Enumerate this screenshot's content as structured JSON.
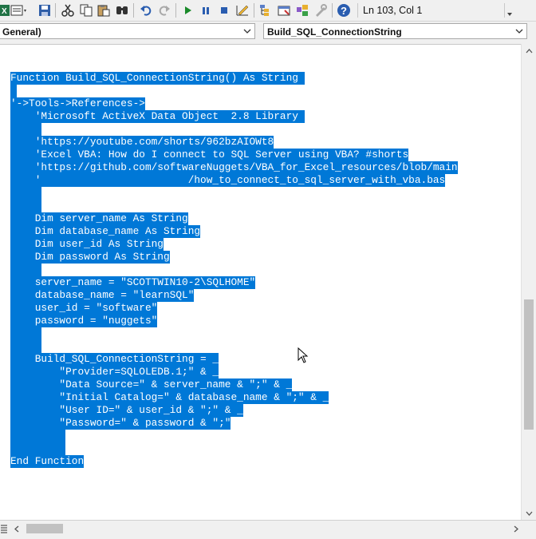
{
  "toolbar": {
    "status": "Ln 103, Col 1",
    "icons": [
      "excel-view-icon",
      "insert-module-icon",
      "save-icon",
      "cut-icon",
      "copy-icon",
      "paste-icon",
      "find-icon",
      "undo-icon",
      "redo-icon",
      "run-icon",
      "break-icon",
      "reset-icon",
      "design-mode-icon",
      "project-explorer-icon",
      "properties-icon",
      "object-browser-icon",
      "toolbox-icon",
      "help-icon"
    ]
  },
  "combos": {
    "object": "General)",
    "procedure": "Build_SQL_ConnectionString"
  },
  "code": {
    "lines": [
      "Function Build_SQL_ConnectionString() As String ",
      "",
      "'->Tools->References->",
      "    'Microsoft ActiveX Data Object  2.8 Library ",
      "",
      "    'https://youtube.com/shorts/962bzAIOWt8",
      "    'Excel VBA: How do I connect to SQL Server using VBA? #shorts",
      "    'https://github.com/softwareNuggets/VBA_for_Excel_resources/blob/main",
      "    '                        /how_to_connect_to_sql_server_with_vba.bas",
      "",
      "",
      "    Dim server_name As String",
      "    Dim database_name As String",
      "    Dim user_id As String",
      "    Dim password As String",
      "",
      "    server_name = \"SCOTTWIN10-2\\SQLHOME\"",
      "    database_name = \"learnSQL\"",
      "    user_id = \"software\"",
      "    password = \"nuggets\"",
      "",
      "",
      "    Build_SQL_ConnectionString = _",
      "        \"Provider=SQLOLEDB.1;\" & _",
      "        \"Data Source=\" & server_name & \";\" & _",
      "        \"Initial Catalog=\" & database_name & \";\" & _",
      "        \"User ID=\" & user_id & \";\" & _",
      "        \"Password=\" & password & \";\"",
      "",
      "",
      "End Function"
    ]
  },
  "colors": {
    "selection": "#0078d7",
    "selection_text": "#ffffff"
  }
}
